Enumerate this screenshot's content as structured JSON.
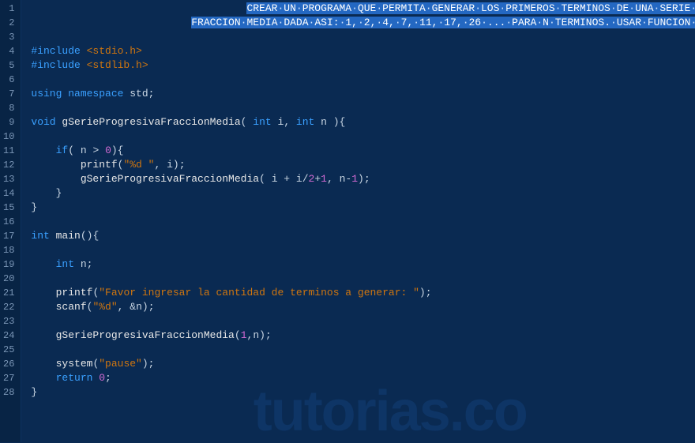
{
  "watermark": "tutorias.co",
  "gutter": {
    "start": 1,
    "end": 28
  },
  "selection_bg": "#2468c2",
  "code_lines": [
    {
      "n": 1,
      "indent": "                                   ",
      "segments": [
        {
          "cls": "sel",
          "html": "CREAR<span class='dot'>·</span>UN<span class='dot'>·</span>PROGRAMA<span class='dot'>·</span>QUE<span class='dot'>·</span>PERMITA<span class='dot'>·</span>GENERAR<span class='dot'>·</span>LOS<span class='dot'>·</span>PRIMEROS<span class='dot'>·</span>TERMINOS<span class='dot'>·</span>DE<span class='dot'>·</span>UNA<span class='dot'>·</span>SERIE<span class='dot'>·</span>PROGRESIVA"
        }
      ]
    },
    {
      "n": 2,
      "indent": "                          ",
      "segments": [
        {
          "cls": "sel",
          "html": "FRACCION<span class='dot'>·</span>MEDIA<span class='dot'>·</span>DADA<span class='dot'>·</span>ASI:<span class='dot'>·</span>1,<span class='dot'>·</span>2,<span class='dot'>·</span>4,<span class='dot'>·</span>7,<span class='dot'>·</span>11,<span class='dot'>·</span>17,<span class='dot'>·</span>26<span class='dot'>·</span>...<span class='dot'>·</span>PARA<span class='dot'>·</span>N<span class='dot'>·</span>TERMINOS.<span class='dot'>·</span>USAR<span class='dot'>·</span>FUNCION<span class='dot'>·</span>RECURSIVA"
        }
      ]
    },
    {
      "n": 3,
      "indent": "",
      "segments": []
    },
    {
      "n": 4,
      "indent": "",
      "segments": [
        {
          "cls": "kw",
          "text": "#include "
        },
        {
          "cls": "inc",
          "text": "<stdio.h>"
        }
      ]
    },
    {
      "n": 5,
      "indent": "",
      "segments": [
        {
          "cls": "kw",
          "text": "#include "
        },
        {
          "cls": "inc",
          "text": "<stdlib.h>"
        }
      ]
    },
    {
      "n": 6,
      "indent": "",
      "segments": []
    },
    {
      "n": 7,
      "indent": "",
      "segments": [
        {
          "cls": "kw",
          "text": "using "
        },
        {
          "cls": "kw",
          "text": "namespace "
        },
        {
          "cls": "txt",
          "text": "std"
        },
        {
          "cls": "punc",
          "text": ";"
        }
      ]
    },
    {
      "n": 8,
      "indent": "",
      "segments": []
    },
    {
      "n": 9,
      "indent": "",
      "segments": [
        {
          "cls": "type",
          "text": "void "
        },
        {
          "cls": "fn",
          "text": "gSerieProgresivaFraccionMedia"
        },
        {
          "cls": "punc",
          "text": "( "
        },
        {
          "cls": "type",
          "text": "int "
        },
        {
          "cls": "txt",
          "text": "i"
        },
        {
          "cls": "punc",
          "text": ", "
        },
        {
          "cls": "type",
          "text": "int "
        },
        {
          "cls": "txt",
          "text": "n "
        },
        {
          "cls": "punc",
          "text": "){"
        }
      ]
    },
    {
      "n": 10,
      "indent": "",
      "segments": []
    },
    {
      "n": 11,
      "indent": "    ",
      "segments": [
        {
          "cls": "kw",
          "text": "if"
        },
        {
          "cls": "punc",
          "text": "( "
        },
        {
          "cls": "txt",
          "text": "n "
        },
        {
          "cls": "op",
          "text": "> "
        },
        {
          "cls": "num",
          "text": "0"
        },
        {
          "cls": "punc",
          "text": "){"
        }
      ]
    },
    {
      "n": 12,
      "indent": "        ",
      "segments": [
        {
          "cls": "fn",
          "text": "printf"
        },
        {
          "cls": "punc",
          "text": "("
        },
        {
          "cls": "str",
          "text": "\"%d \""
        },
        {
          "cls": "punc",
          "text": ", "
        },
        {
          "cls": "txt",
          "text": "i"
        },
        {
          "cls": "punc",
          "text": ");"
        }
      ]
    },
    {
      "n": 13,
      "indent": "        ",
      "segments": [
        {
          "cls": "fn",
          "text": "gSerieProgresivaFraccionMedia"
        },
        {
          "cls": "punc",
          "text": "( "
        },
        {
          "cls": "txt",
          "text": "i "
        },
        {
          "cls": "op",
          "text": "+ "
        },
        {
          "cls": "txt",
          "text": "i"
        },
        {
          "cls": "op",
          "text": "/"
        },
        {
          "cls": "num",
          "text": "2"
        },
        {
          "cls": "op",
          "text": "+"
        },
        {
          "cls": "num",
          "text": "1"
        },
        {
          "cls": "punc",
          "text": ", "
        },
        {
          "cls": "txt",
          "text": "n"
        },
        {
          "cls": "op",
          "text": "-"
        },
        {
          "cls": "num",
          "text": "1"
        },
        {
          "cls": "punc",
          "text": ");"
        }
      ]
    },
    {
      "n": 14,
      "indent": "    ",
      "segments": [
        {
          "cls": "punc",
          "text": "}"
        }
      ]
    },
    {
      "n": 15,
      "indent": "",
      "segments": [
        {
          "cls": "punc",
          "text": "}"
        }
      ]
    },
    {
      "n": 16,
      "indent": "",
      "segments": []
    },
    {
      "n": 17,
      "indent": "",
      "segments": [
        {
          "cls": "type",
          "text": "int "
        },
        {
          "cls": "fn",
          "text": "main"
        },
        {
          "cls": "punc",
          "text": "(){"
        }
      ]
    },
    {
      "n": 18,
      "indent": "",
      "segments": []
    },
    {
      "n": 19,
      "indent": "    ",
      "segments": [
        {
          "cls": "type",
          "text": "int "
        },
        {
          "cls": "txt",
          "text": "n"
        },
        {
          "cls": "punc",
          "text": ";"
        }
      ]
    },
    {
      "n": 20,
      "indent": "",
      "segments": []
    },
    {
      "n": 21,
      "indent": "    ",
      "segments": [
        {
          "cls": "fn",
          "text": "printf"
        },
        {
          "cls": "punc",
          "text": "("
        },
        {
          "cls": "str",
          "text": "\"Favor ingresar la cantidad de terminos a generar: \""
        },
        {
          "cls": "punc",
          "text": ");"
        }
      ]
    },
    {
      "n": 22,
      "indent": "    ",
      "segments": [
        {
          "cls": "fn",
          "text": "scanf"
        },
        {
          "cls": "punc",
          "text": "("
        },
        {
          "cls": "str",
          "text": "\"%d\""
        },
        {
          "cls": "punc",
          "text": ", "
        },
        {
          "cls": "op",
          "text": "&"
        },
        {
          "cls": "txt",
          "text": "n"
        },
        {
          "cls": "punc",
          "text": ");"
        }
      ]
    },
    {
      "n": 23,
      "indent": "",
      "segments": []
    },
    {
      "n": 24,
      "indent": "    ",
      "segments": [
        {
          "cls": "fn",
          "text": "gSerieProgresivaFraccionMedia"
        },
        {
          "cls": "punc",
          "text": "("
        },
        {
          "cls": "num",
          "text": "1"
        },
        {
          "cls": "punc",
          "text": ","
        },
        {
          "cls": "txt",
          "text": "n"
        },
        {
          "cls": "punc",
          "text": ");"
        }
      ]
    },
    {
      "n": 25,
      "indent": "",
      "segments": []
    },
    {
      "n": 26,
      "indent": "    ",
      "segments": [
        {
          "cls": "fn",
          "text": "system"
        },
        {
          "cls": "punc",
          "text": "("
        },
        {
          "cls": "str",
          "text": "\"pause\""
        },
        {
          "cls": "punc",
          "text": ");"
        }
      ]
    },
    {
      "n": 27,
      "indent": "    ",
      "segments": [
        {
          "cls": "kw",
          "text": "return "
        },
        {
          "cls": "num",
          "text": "0"
        },
        {
          "cls": "punc",
          "text": ";"
        }
      ]
    },
    {
      "n": 28,
      "indent": "",
      "segments": [
        {
          "cls": "punc",
          "text": "}"
        }
      ]
    }
  ]
}
